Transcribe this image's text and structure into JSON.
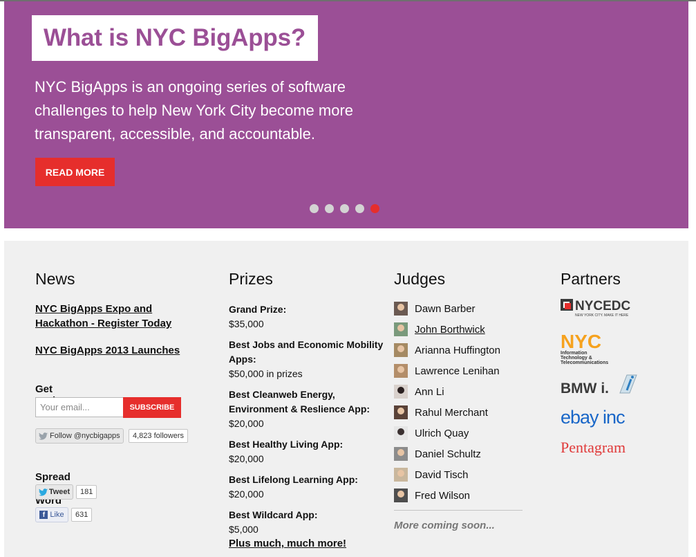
{
  "hero": {
    "title": "What is NYC BigApps?",
    "text": "NYC BigApps is an ongoing series of software challenges to help New York City become more transparent, accessible, and accountable.",
    "button": "READ MORE",
    "slides": 5,
    "active_slide": 5,
    "colors": {
      "background": "#9b4f96",
      "accent": "#e62e2c"
    }
  },
  "news": {
    "heading": "News",
    "items": [
      "NYC BigApps Expo and Hackathon - Register Today",
      "NYC BigApps 2013 Launches"
    ],
    "updates_heading": "Get Updates",
    "email_placeholder": "Your email...",
    "subscribe": "SUBSCRIBE",
    "follow": "Follow @nycbigapps",
    "followers": "4,823 followers",
    "spread_heading": "Spread the Word",
    "tweet": "Tweet",
    "tweet_count": "181",
    "like": "Like",
    "like_count": "631"
  },
  "prizes": {
    "heading": "Prizes",
    "items": [
      {
        "title": "Grand Prize:",
        "amount": "$35,000"
      },
      {
        "title": "Best Jobs and Economic Mobility Apps:",
        "amount": "$50,000 in prizes"
      },
      {
        "title": "Best Cleanweb Energy, Environment & Reslience App:",
        "amount": "$20,000"
      },
      {
        "title": "Best Healthy Living App:",
        "amount": "$20,000"
      },
      {
        "title": "Best Lifelong Learning App:",
        "amount": "$20,000"
      },
      {
        "title": "Best Wildcard App:",
        "amount": "$5,000"
      }
    ],
    "more": "Plus much, much more!"
  },
  "judges": {
    "heading": "Judges",
    "items": [
      "Dawn Barber",
      "John Borthwick",
      "Arianna Huffington",
      "Lawrence Lenihan",
      "Ann Li",
      "Rahul Merchant",
      "Ulrich Quay",
      "Daniel Schultz",
      "David Tisch",
      "Fred Wilson"
    ],
    "more": "More coming soon..."
  },
  "partners": {
    "heading": "Partners",
    "nycedc": "NYCEDC",
    "nycedc_tag": "NEW YORK CITY. MAKE IT HERE",
    "nyc": "NYC",
    "nyc_sub1": "Information",
    "nyc_sub2": "Technology &",
    "nyc_sub3": "Telecommunications",
    "bmwi": "BMW i.",
    "ebay": "ebay inc",
    "pentagram": "Pentagram"
  }
}
